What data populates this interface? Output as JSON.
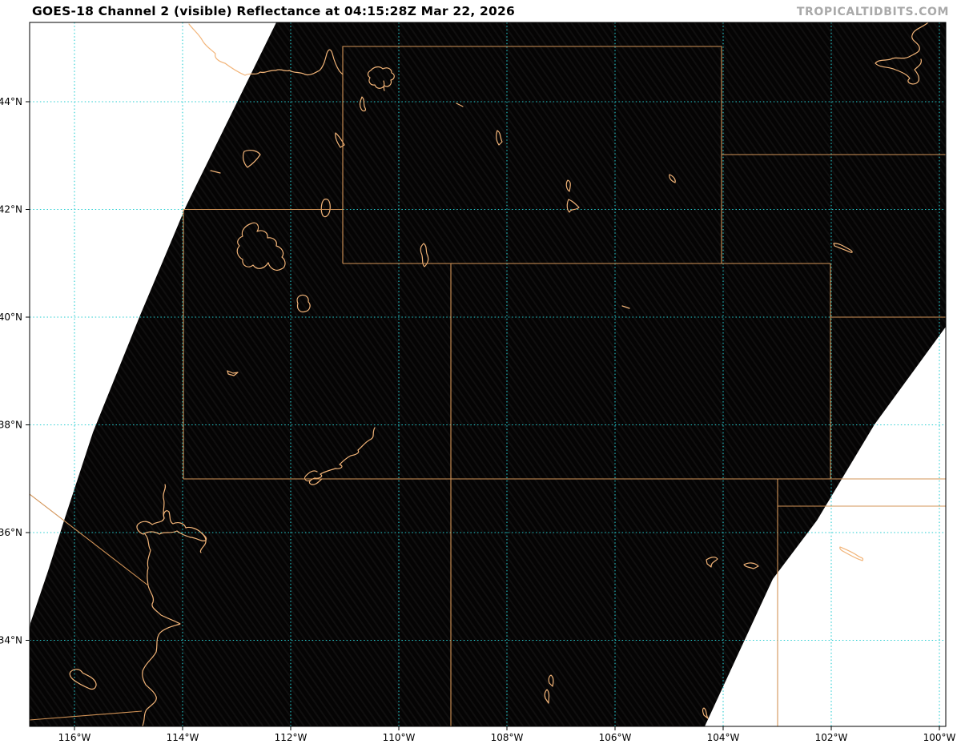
{
  "header": {
    "title": "GOES-18 Channel 2 (visible) Reflectance at 04:15:28Z Mar 22, 2026",
    "watermark": "TROPICALTIDBITS.COM"
  },
  "axes": {
    "x_tick_labels": [
      "116°W",
      "114°W",
      "112°W",
      "110°W",
      "108°W",
      "106°W",
      "104°W",
      "102°W",
      "100°W"
    ],
    "y_tick_labels": [
      "44°N",
      "42°N",
      "40°N",
      "38°N",
      "36°N",
      "34°N"
    ]
  },
  "colors": {
    "state_border": "#d39457",
    "water_feature": "#f2b478",
    "gridline": "#25cdd1",
    "satellite_background": "#050404",
    "no_data": "#ffffff",
    "axis_text": "#000000",
    "watermark": "#a9a9a9"
  }
}
